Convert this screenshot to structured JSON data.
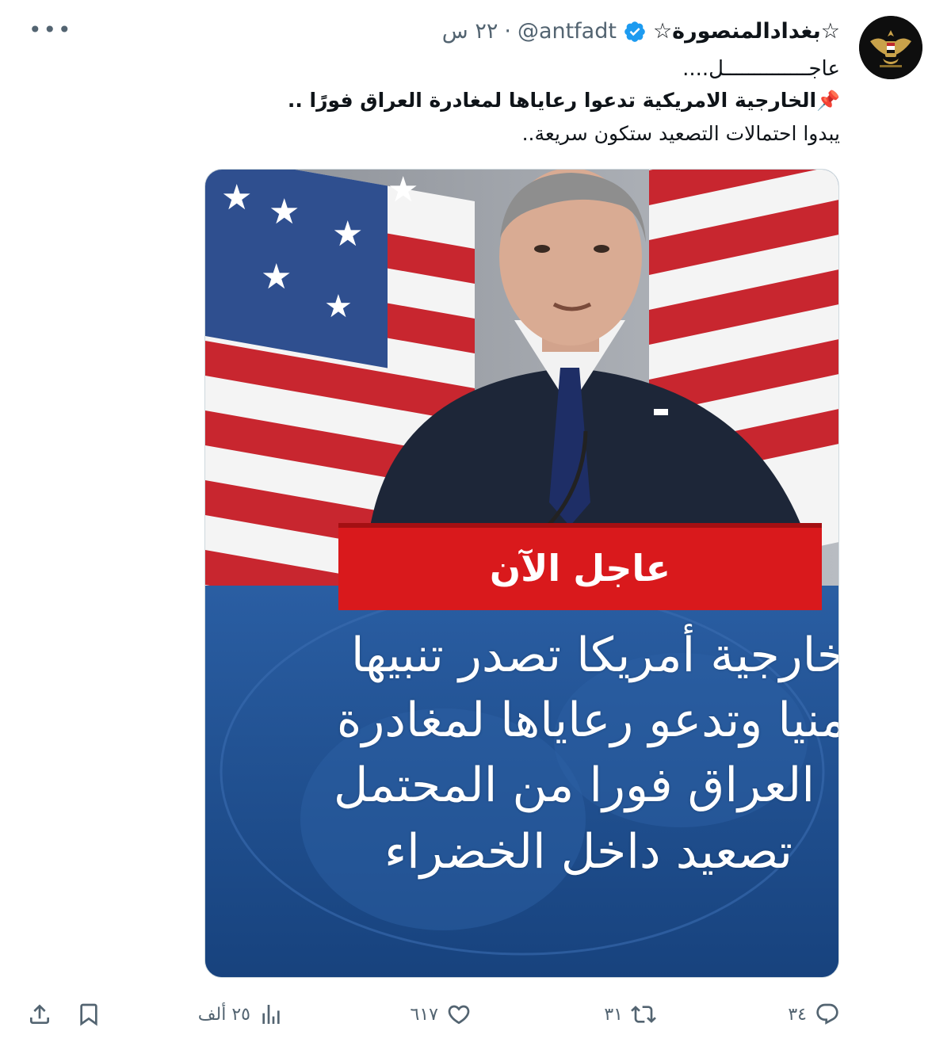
{
  "tweet": {
    "display_name": "☆بغدادالمنصورة☆",
    "handle": "@antfadt",
    "separator": "·",
    "time": "٢٢ س",
    "more_icon": "more-icon",
    "lines": {
      "line1": "عاجــــــــــــــل....",
      "line2_icon": "📌",
      "line2": "الخارجية الامريكية تدعوا رعاياها لمغادرة العراق فورًا ..",
      "line3": "يبدوا احتمالات التصعيد ستكون سريعة.."
    }
  },
  "media": {
    "banner_label": "عاجل الآن",
    "lines": [
      "خارجية أمريكا تصدر تنبيها",
      "منيا وتدعو رعاياها لمغادرة",
      "العراق فورا من المحتمل",
      "تصعيد داخل الخضراء"
    ]
  },
  "actions": {
    "reply_count": "٣٤",
    "retweet_count": "٣١",
    "like_count": "٦١٧",
    "views_count": "٢٥ ألف"
  },
  "colors": {
    "secondary_text": "#536471",
    "verified": "#1d9bf0",
    "banner_red": "#d9191c",
    "media_blue": "#1f4f8e"
  }
}
